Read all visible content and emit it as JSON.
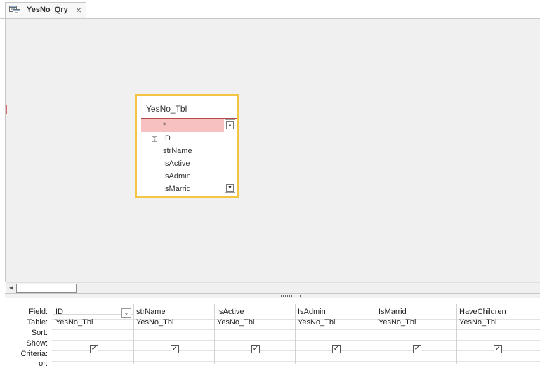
{
  "tab": {
    "title": "YesNo_Qry",
    "icon": "query-icon",
    "close": "×"
  },
  "table": {
    "title": "YesNo_Tbl",
    "fields": [
      {
        "name": "*",
        "primary_key": false,
        "selected": true
      },
      {
        "name": "ID",
        "primary_key": true,
        "selected": false
      },
      {
        "name": "strName",
        "primary_key": false,
        "selected": false
      },
      {
        "name": "IsActive",
        "primary_key": false,
        "selected": false
      },
      {
        "name": "IsAdmin",
        "primary_key": false,
        "selected": false
      },
      {
        "name": "IsMarrid",
        "primary_key": false,
        "selected": false
      }
    ]
  },
  "grid": {
    "row_labels": [
      "Field:",
      "Table:",
      "Sort:",
      "Show:",
      "Criteria:",
      "or:"
    ],
    "columns": [
      {
        "field": "ID",
        "table": "YesNo_Tbl",
        "show": true
      },
      {
        "field": "strName",
        "table": "YesNo_Tbl",
        "show": true
      },
      {
        "field": "IsActive",
        "table": "YesNo_Tbl",
        "show": true
      },
      {
        "field": "IsAdmin",
        "table": "YesNo_Tbl",
        "show": true
      },
      {
        "field": "IsMarrid",
        "table": "YesNo_Tbl",
        "show": true
      },
      {
        "field": "HaveChildren",
        "table": "YesNo_Tbl",
        "show": true
      }
    ]
  },
  "colors": {
    "table_border": "#f4c542",
    "selected_field": "#f7c1c1",
    "design_background": "#f0f0f0"
  }
}
